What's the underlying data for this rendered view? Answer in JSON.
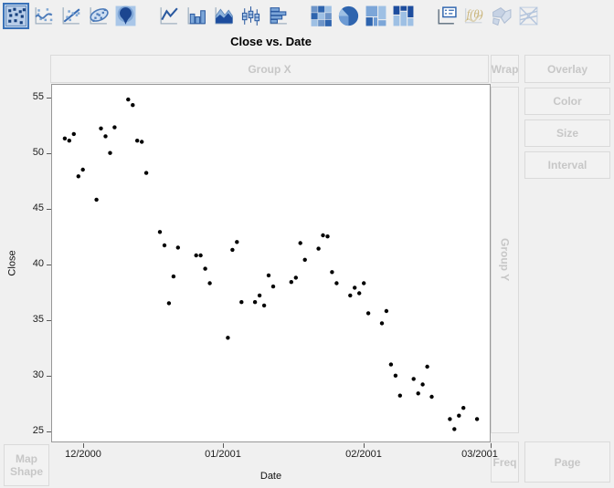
{
  "toolbar": {
    "buttons": [
      {
        "id": "points",
        "selected": true,
        "disabled": false,
        "group": 1
      },
      {
        "id": "smoother",
        "selected": false,
        "disabled": false,
        "group": 1
      },
      {
        "id": "line-of-fit",
        "selected": false,
        "disabled": false,
        "group": 1
      },
      {
        "id": "ellipse",
        "selected": false,
        "disabled": false,
        "group": 1
      },
      {
        "id": "contour",
        "selected": false,
        "disabled": false,
        "group": 1
      },
      {
        "id": "line",
        "selected": false,
        "disabled": false,
        "group": 2
      },
      {
        "id": "bar",
        "selected": false,
        "disabled": false,
        "group": 2
      },
      {
        "id": "area",
        "selected": false,
        "disabled": false,
        "group": 2
      },
      {
        "id": "box-plot",
        "selected": false,
        "disabled": false,
        "group": 2
      },
      {
        "id": "histogram",
        "selected": false,
        "disabled": false,
        "group": 2
      },
      {
        "id": "heatmap",
        "selected": false,
        "disabled": false,
        "group": 3
      },
      {
        "id": "pie",
        "selected": false,
        "disabled": false,
        "group": 3
      },
      {
        "id": "treemap",
        "selected": false,
        "disabled": false,
        "group": 3
      },
      {
        "id": "mosaic",
        "selected": false,
        "disabled": false,
        "group": 3
      },
      {
        "id": "caption-box",
        "selected": false,
        "disabled": false,
        "group": 4
      },
      {
        "id": "formula",
        "selected": false,
        "disabled": true,
        "group": 4
      },
      {
        "id": "map-shapes",
        "selected": false,
        "disabled": true,
        "group": 4
      },
      {
        "id": "parallel",
        "selected": false,
        "disabled": true,
        "group": 4
      }
    ]
  },
  "drop_zones": {
    "group_x": {
      "label": "Group X"
    },
    "wrap": {
      "label": "Wrap"
    },
    "overlay": {
      "label": "Overlay"
    },
    "color": {
      "label": "Color"
    },
    "size": {
      "label": "Size"
    },
    "interval": {
      "label": "Interval"
    },
    "group_y": {
      "label": "Group Y"
    },
    "map_shape": {
      "label": "Map Shape"
    },
    "freq": {
      "label": "Freq"
    },
    "page": {
      "label": "Page"
    }
  },
  "chart_data": {
    "type": "scatter",
    "title": "Close vs. Date",
    "xlabel": "Date",
    "ylabel": "Close",
    "legend": "none",
    "grid": false,
    "marker": {
      "color": "#000000",
      "radius_px": 2.2
    },
    "x_axis": {
      "range": [
        "2000-11-24",
        "2001-03-01"
      ],
      "tick_dates": [
        "2000-12-01",
        "2001-01-01",
        "2001-02-01",
        "2001-03-01"
      ],
      "tick_labels": [
        "12/2000",
        "01/2001",
        "02/2001",
        "03/2001"
      ]
    },
    "y_axis": {
      "range": [
        24.0,
        56.2
      ],
      "ticks": [
        25,
        30,
        35,
        40,
        45,
        50,
        55
      ]
    },
    "points": {
      "dates": [
        "2000-11-27",
        "2000-11-28",
        "2000-11-29",
        "2000-11-30",
        "2000-12-01",
        "2000-12-04",
        "2000-12-05",
        "2000-12-06",
        "2000-12-07",
        "2000-12-08",
        "2000-12-11",
        "2000-12-12",
        "2000-12-13",
        "2000-12-14",
        "2000-12-15",
        "2000-12-18",
        "2000-12-19",
        "2000-12-20",
        "2000-12-21",
        "2000-12-22",
        "2000-12-26",
        "2000-12-27",
        "2000-12-28",
        "2000-12-29",
        "2001-01-02",
        "2001-01-03",
        "2001-01-04",
        "2001-01-05",
        "2001-01-08",
        "2001-01-09",
        "2001-01-10",
        "2001-01-11",
        "2001-01-12",
        "2001-01-16",
        "2001-01-17",
        "2001-01-18",
        "2001-01-19",
        "2001-01-22",
        "2001-01-23",
        "2001-01-24",
        "2001-01-25",
        "2001-01-26",
        "2001-01-29",
        "2001-01-30",
        "2001-01-31",
        "2001-02-01",
        "2001-02-02",
        "2001-02-05",
        "2001-02-06",
        "2001-02-07",
        "2001-02-08",
        "2001-02-09",
        "2001-02-12",
        "2001-02-13",
        "2001-02-14",
        "2001-02-15",
        "2001-02-16",
        "2001-02-20",
        "2001-02-21",
        "2001-02-22",
        "2001-02-23",
        "2001-02-26"
      ],
      "close": [
        51.3,
        51.1,
        51.7,
        47.9,
        48.5,
        45.8,
        52.2,
        51.5,
        50.0,
        52.3,
        54.8,
        54.3,
        51.1,
        51.0,
        48.2,
        42.9,
        41.7,
        36.5,
        38.9,
        41.5,
        40.8,
        40.8,
        39.6,
        38.3,
        33.4,
        41.3,
        42.0,
        36.6,
        36.6,
        37.2,
        36.3,
        39.0,
        38.0,
        38.4,
        38.8,
        41.9,
        40.4,
        41.4,
        42.6,
        42.5,
        39.3,
        38.3,
        37.2,
        37.9,
        37.4,
        38.3,
        35.6,
        34.7,
        35.8,
        31.0,
        30.0,
        28.2,
        29.7,
        28.4,
        29.2,
        30.8,
        28.1,
        26.1,
        25.2,
        26.4,
        27.1,
        26.1
      ]
    }
  },
  "colors": {
    "window_bg": "#f0f0f0",
    "plot_bg": "#ffffff",
    "plot_border": "#979797",
    "zone_bg": "#f2f2f2",
    "zone_border": "#dadada",
    "zone_label": "#c7c7c7",
    "icon_blue": "#2e64ae",
    "selected_button_bg": "#c3d7ee",
    "selected_button_border": "#3a72b8",
    "point_color": "#000000"
  }
}
